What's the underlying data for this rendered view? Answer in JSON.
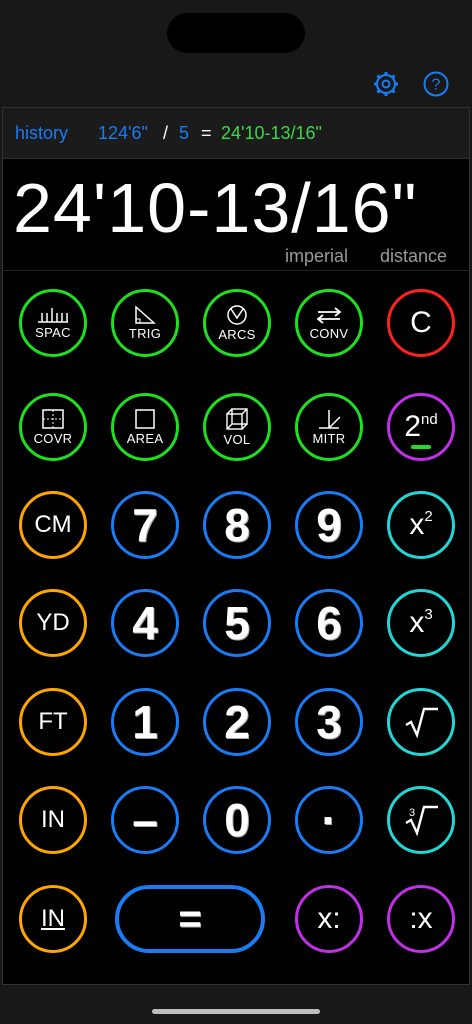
{
  "header": {
    "settings_icon": "gear-icon",
    "help_icon": "question-icon",
    "accent_color": "#1a7cf5"
  },
  "history": {
    "label": "history",
    "operand1": "124'6\"",
    "operator": "/",
    "operand2": "5",
    "equals": "=",
    "result": "24'10-13/16\""
  },
  "display": {
    "value": "24'10-13/16\"",
    "system": "imperial",
    "mode": "distance"
  },
  "keys": {
    "spac": "SPAC",
    "trig": "TRIG",
    "arcs": "ARCS",
    "conv": "CONV",
    "clear": "C",
    "covr": "COVR",
    "area": "AREA",
    "vol": "VOL",
    "mitr": "MITR",
    "second": "2",
    "second_sup": "nd",
    "cm": "CM",
    "n7": "7",
    "n8": "8",
    "n9": "9",
    "square": "x",
    "square_sup": "2",
    "yd": "YD",
    "n4": "4",
    "n5": "5",
    "n6": "6",
    "cube": "x",
    "cube_sup": "3",
    "ft": "FT",
    "n1": "1",
    "n2": "2",
    "n3": "3",
    "in": "IN",
    "minus": "–",
    "n0": "0",
    "dot": "·",
    "in_fraction": "IN",
    "equals": "=",
    "xdiv": "x:",
    "divx": ":x"
  },
  "colors": {
    "function": "#1ee01e",
    "clear": "#ff2020",
    "second": "#c030e8",
    "units": "#ffa500",
    "digits": "#1a7cf5",
    "powers": "#22d6d6",
    "history_result": "#3ed64a"
  }
}
